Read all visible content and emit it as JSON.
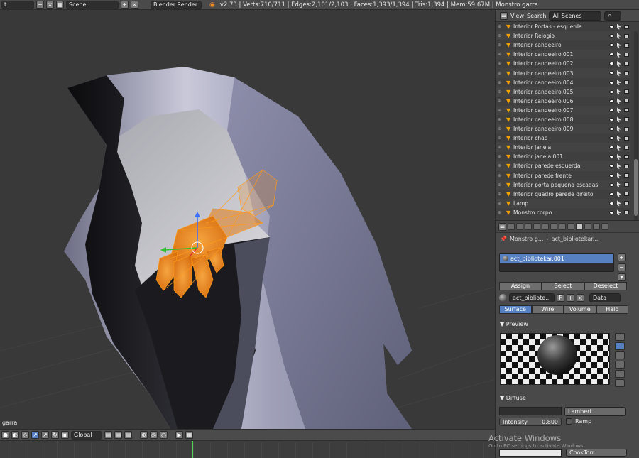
{
  "topbar": {
    "scene": "Scene",
    "renderer": "Blender Render",
    "stats": "v2.73 | Verts:710/711 | Edges:2,101/2,103 | Faces:1,393/1,394 | Tris:1,394 | Mem:59.67M | Monstro garra"
  },
  "viewport": {
    "object_label": "garra"
  },
  "viewport_bar": {
    "orientation": "Global"
  },
  "outliner": {
    "menu_view": "View",
    "menu_search": "Search",
    "scope": "All Scenes",
    "items": [
      "Interior Portas - esquerda",
      "Interior Relogio",
      "Interior candeeiro",
      "Interior candeeiro.001",
      "Interior candeeiro.002",
      "Interior candeeiro.003",
      "Interior candeeiro.004",
      "Interior candeeiro.005",
      "Interior candeeiro.006",
      "Interior candeeiro.007",
      "Interior candeeiro.008",
      "Interior candeeiro.009",
      "Interior chao",
      "Interior janela",
      "Interior janela.001",
      "Interior parede esquerda",
      "Interior parede frente",
      "Interior porta pequena escadas",
      "Interior quadro parede direito",
      "Lamp",
      "Monstro corpo"
    ]
  },
  "properties": {
    "crumb_object": "Monstro g...",
    "crumb_material": "act_bibliotekar...",
    "slot": "act_bibliotekar.001",
    "assign": "Assign",
    "select": "Select",
    "deselect": "Deselect",
    "material_name": "act_bibliote...",
    "fake": "F",
    "link": "Data",
    "tabs": [
      "Surface",
      "Wire",
      "Volume",
      "Halo"
    ],
    "preview_header": "Preview",
    "diffuse_header": "Diffuse",
    "diffuse_shader": "Lambert",
    "intensity_label": "Intensity:",
    "intensity_value": "0.800",
    "ramp": "Ramp",
    "specular_shader": "CookTorr"
  },
  "watermark": {
    "line1": "Activate Windows",
    "line2": "Go to PC settings to activate Windows."
  }
}
